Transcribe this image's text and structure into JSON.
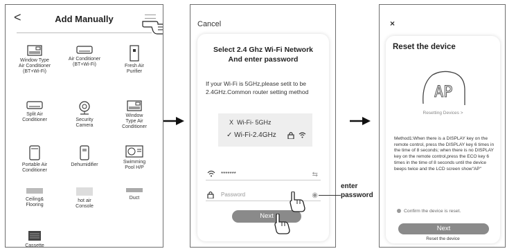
{
  "panel1": {
    "title": "Add Manually",
    "back_glyph": "<",
    "devices": [
      {
        "label": "Window Type\nAir Conditioner\n(BT+Wi-Fi)",
        "icon": "window-ac-icon"
      },
      {
        "label": "Air Conditioner\n(BT+Wi-Fi)",
        "icon": "split-ac-icon"
      },
      {
        "label": "Fresh Air\nPurifier",
        "icon": "purifier-icon"
      },
      {
        "label": "Split Air\nConditioner",
        "icon": "split-ac-icon"
      },
      {
        "label": "Security\nCamera",
        "icon": "camera-icon"
      },
      {
        "label": "Window\nType Air\nConditioner",
        "icon": "window-ac-icon"
      },
      {
        "label": "Portable Air\nConditioner",
        "icon": "portable-ac-icon"
      },
      {
        "label": "Dehumidifier",
        "icon": "dehumidifier-icon"
      },
      {
        "label": "Swimming\nPool H/P",
        "icon": "pool-heatpump-icon"
      },
      {
        "label": "Ceiling&\nFlooring",
        "icon": "ceiling-icon"
      },
      {
        "label": "hot air\nConsole",
        "icon": "console-icon"
      },
      {
        "label": "Duct",
        "icon": "duct-icon"
      },
      {
        "label": "Cassette",
        "icon": "cassette-icon"
      }
    ]
  },
  "panel2": {
    "cancel_label": "Cancel",
    "title_line1": "Select 2.4 Ghz Wi-Fi Network",
    "title_line2": "And enter password",
    "description": "If your Wi-Fi is 5GHz,please setit to be 2.4GHz.Common router setting method",
    "wifi_5g": "Wi-Fi- 5GHz",
    "wifi_5g_mark": "X",
    "wifi_24g": "Wi-Fi-2.4GHz",
    "wifi_24g_mark": "✓",
    "ssid_value": "*******",
    "password_placeholder": "Password",
    "next_label": "Next"
  },
  "annotation": {
    "line1": "enter",
    "line2": "password"
  },
  "panel3": {
    "close_glyph": "×",
    "title": "Reset the device",
    "display_text": "AP",
    "resetting_link": "Resetting Devices >",
    "method_text": "Method1:When there is a DISPLAY key on the remote control, press the DISPLAY key 6 times in the time of 8 seconds; when there is no DISPLAY key on the remote control,press the ECO key 6 times in the time of 8 seconds until the device beeps twice and the LCD screen show\"AP\"",
    "confirm_label": "Confirm the device is reset.",
    "next_label": "Next",
    "reset_label": "Reset the device"
  },
  "colors": {
    "button_gray": "#8a8a8a",
    "border_gray": "#6d6d6d",
    "wifi_box_bg": "#eeeeee"
  }
}
